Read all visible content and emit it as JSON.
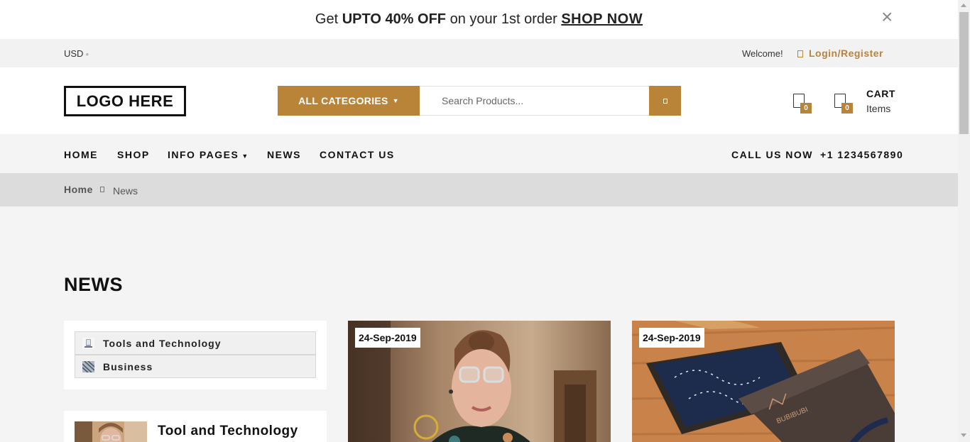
{
  "promo": {
    "pre": "Get ",
    "bold": "UPTO 40% OFF",
    "mid": " on your 1st order ",
    "link": "SHOP NOW",
    "close": "×"
  },
  "topbar": {
    "currency": "USD",
    "welcome": "Welcome!",
    "login": "Login/Register"
  },
  "header": {
    "logo": "LOGO HERE",
    "categories_label": "ALL CATEGORIES",
    "search_placeholder": "Search Products...",
    "wishlist_count": "0",
    "cart_count": "0",
    "cart_label": "CART",
    "cart_items": "Items"
  },
  "nav": {
    "items": [
      {
        "label": "HOME"
      },
      {
        "label": "SHOP"
      },
      {
        "label": "INFO PAGES"
      },
      {
        "label": "NEWS"
      },
      {
        "label": "CONTACT US"
      }
    ],
    "call_label": "CALL US NOW",
    "call_number": "+1 1234567890"
  },
  "breadcrumb": {
    "home": "Home",
    "current": "News"
  },
  "page": {
    "title": "NEWS"
  },
  "categories": [
    {
      "label": "Tools and Technology"
    },
    {
      "label": "Business"
    }
  ],
  "recent": {
    "title": "Tool and Technology"
  },
  "posts": [
    {
      "date": "24-Sep-2019"
    },
    {
      "date": "24-Sep-2019"
    }
  ],
  "colors": {
    "accent": "#b98338",
    "page_bg": "#f4f4f4",
    "breadcrumb_bg": "#dcdcdc"
  }
}
